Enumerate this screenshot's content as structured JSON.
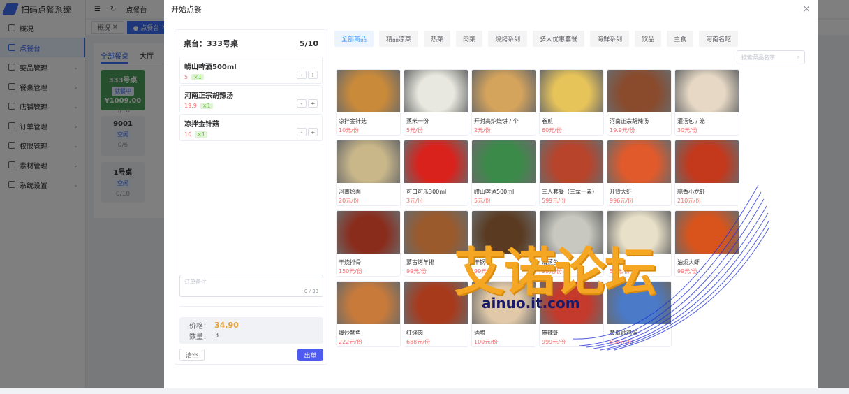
{
  "app": {
    "title": "扫码点餐系统",
    "header_page": "点餐台"
  },
  "sidebar": {
    "items": [
      {
        "label": "概况"
      },
      {
        "label": "点餐台"
      },
      {
        "label": "菜品管理"
      },
      {
        "label": "餐桌管理"
      },
      {
        "label": "店铺管理"
      },
      {
        "label": "订单管理"
      },
      {
        "label": "权限管理"
      },
      {
        "label": "素材管理"
      },
      {
        "label": "系统设置"
      }
    ]
  },
  "page_tabs": [
    {
      "label": "概况"
    },
    {
      "label": "● 点餐台"
    }
  ],
  "bg_content": {
    "subtabs": [
      "全部餐桌",
      "大厅"
    ],
    "cards": [
      {
        "name": "333号桌",
        "status": "就餐中",
        "amount": "¥1009.00",
        "seats": "5/10"
      },
      {
        "name": "9001",
        "status": "空闲",
        "seats": "0/6"
      },
      {
        "name": "1号桌",
        "status": "空闲",
        "seats": "0/10"
      }
    ]
  },
  "drawer": {
    "title": "开始点餐",
    "close": "×"
  },
  "order": {
    "table": "桌台：333号桌",
    "seats": "5/10",
    "items": [
      {
        "name": "崂山啤酒500ml",
        "price": "5",
        "qty": "×1"
      },
      {
        "name": "河南正宗胡辣汤",
        "price": "19.9",
        "qty": "×1"
      },
      {
        "name": "凉拌金针菇",
        "price": "10",
        "qty": "×1"
      }
    ],
    "remark_placeholder": "订单备注",
    "remark_count": "0 / 30",
    "price_label": "价格：",
    "price_value": "34.90",
    "count_label": "数量：",
    "count_value": "3",
    "clear_label": "清空",
    "submit_label": "出单"
  },
  "categories": [
    "全部商品",
    "精品凉菜",
    "热菜",
    "肉菜",
    "烧烤系列",
    "多人优惠套餐",
    "海鲜系列",
    "饮品",
    "主食",
    "河南名吃"
  ],
  "search_placeholder": "搜索菜品名字",
  "dishes": [
    {
      "name": "凉拌金针菇",
      "price": "10元/份",
      "color": "#c98a3a"
    },
    {
      "name": "蒸米一份",
      "price": "5元/份",
      "color": "#e8e8e0"
    },
    {
      "name": "开封高炉烧饼 / 个",
      "price": "2元/份",
      "color": "#d4a35c"
    },
    {
      "name": "卷煎",
      "price": "60元/份",
      "color": "#e7c45a"
    },
    {
      "name": "河南正宗胡辣汤",
      "price": "19.9元/份",
      "color": "#8a4a2c"
    },
    {
      "name": "灌汤包 / 笼",
      "price": "30元/份",
      "color": "#e6d8c4"
    },
    {
      "name": "河南烩面",
      "price": "20元/份",
      "color": "#c9b78a"
    },
    {
      "name": "可口可乐300ml",
      "price": "3元/份",
      "color": "#d9221c"
    },
    {
      "name": "崂山啤酒500ml",
      "price": "5元/份",
      "color": "#3c8a4a"
    },
    {
      "name": "三人套餐（三荤一素）",
      "price": "599元/份",
      "color": "#b8442c"
    },
    {
      "name": "开背大虾",
      "price": "996元/份",
      "color": "#e05a2c"
    },
    {
      "name": "蒜香小龙虾",
      "price": "210元/份",
      "color": "#c4381c"
    },
    {
      "name": "干烧排骨",
      "price": "150元/份",
      "color": "#8a2c1c"
    },
    {
      "name": "蒙古烤羊排",
      "price": "99元/份",
      "color": "#9a5a2c"
    },
    {
      "name": "干锅",
      "price": "99元/份",
      "color": "#5a3a20"
    },
    {
      "name": "清蒸鱼",
      "price": "99元/份",
      "color": "#c8c8c0"
    },
    {
      "name": "春卷",
      "price": "50元/份",
      "color": "#e8e0c8"
    },
    {
      "name": "油焖大虾",
      "price": "99元/份",
      "color": "#d9541c"
    },
    {
      "name": "爆炒鱿鱼",
      "price": "222元/份",
      "color": "#c87a3a"
    },
    {
      "name": "红烧肉",
      "price": "688元/份",
      "color": "#a83a1c"
    },
    {
      "name": "酒酿",
      "price": "100元/份",
      "color": "#e0c8a8"
    },
    {
      "name": "麻辣虾",
      "price": "999元/份",
      "color": "#c43a2c"
    },
    {
      "name": "黄瓜炒鸡蛋",
      "price": "888元/份",
      "color": "#4a7ac8"
    }
  ],
  "watermark": {
    "text": "艾诺论坛",
    "url": "ainuo.it.com"
  }
}
